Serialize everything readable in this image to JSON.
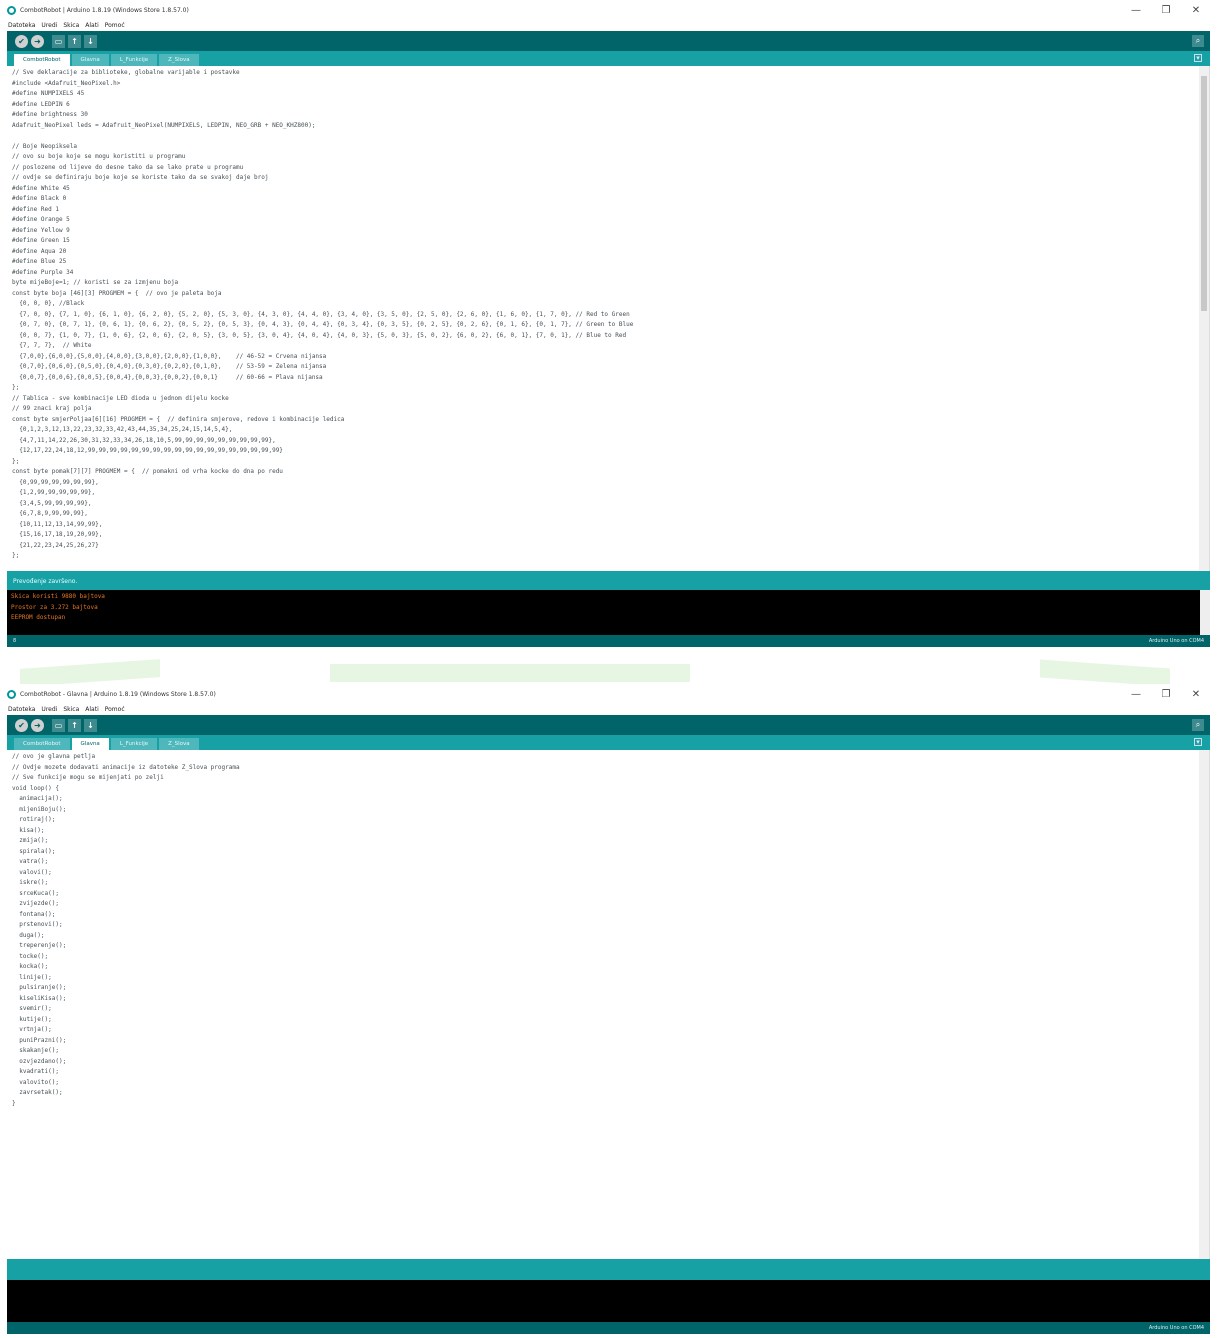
{
  "win1": {
    "title": "CombotRobot | Arduino 1.8.19 (Windows Store 1.8.57.0)",
    "menus": [
      "Datoteka",
      "Uredi",
      "Skica",
      "Alati",
      "Pomoć"
    ],
    "tabs": [
      "CombotRobot",
      "Glavna",
      "L_Funkcije",
      "Z_Slova"
    ],
    "active_tab": 0,
    "code": [
      "// Sve deklaracije za biblioteke, globalne varijable i postavke",
      "#include <Adafruit_NeoPixel.h>",
      "#define NUMPIXELS 45",
      "#define LEDPIN 6",
      "#define brightness 30",
      "Adafruit_NeoPixel leds = Adafruit_NeoPixel(NUMPIXELS, LEDPIN, NEO_GRB + NEO_KHZ800);",
      "",
      "// Boje Neopiksela",
      "// ovo su boje koje se mogu koristiti u programu",
      "// poslozene od lijeve do desne tako da se lako prate u programu",
      "// ovdje se definiraju boje koje se koriste tako da se svakoj daje broj",
      "#define White 45",
      "#define Black 0",
      "#define Red 1",
      "#define Orange 5",
      "#define Yellow 9",
      "#define Green 15",
      "#define Aqua 20",
      "#define Blue 25",
      "#define Purple 34",
      "byte mijeBoje=1; // koristi se za izmjenu boja",
      "const byte boja [46][3] PROGMEM = {  // ovo je paleta boja",
      "  {0, 0, 0}, //Black",
      "  {7, 0, 0}, {7, 1, 0}, {6, 1, 0}, {6, 2, 0}, {5, 2, 0}, {5, 3, 0}, {4, 3, 0}, {4, 4, 0}, {3, 4, 0}, {3, 5, 0}, {2, 5, 0}, {2, 6, 0}, {1, 6, 0}, {1, 7, 0}, // Red to Green",
      "  {0, 7, 0}, {0, 7, 1}, {0, 6, 1}, {0, 6, 2}, {0, 5, 2}, {0, 5, 3}, {0, 4, 3}, {0, 4, 4}, {0, 3, 4}, {0, 3, 5}, {0, 2, 5}, {0, 2, 6}, {0, 1, 6}, {0, 1, 7}, // Green to Blue",
      "  {0, 0, 7}, {1, 0, 7}, {1, 0, 6}, {2, 0, 6}, {2, 0, 5}, {3, 0, 5}, {3, 0, 4}, {4, 0, 4}, {4, 0, 3}, {5, 0, 3}, {5, 0, 2}, {6, 0, 2}, {6, 0, 1}, {7, 0, 1}, // Blue to Red",
      "  {7, 7, 7},  // White",
      "  {7,0,0},{6,0,0},{5,0,0},{4,0,0},{3,0,0},{2,0,0},{1,0,0},    // 46-52 = Crvena nijansa",
      "  {0,7,0},{0,6,0},{0,5,0},{0,4,0},{0,3,0},{0,2,0},{0,1,0},    // 53-59 = Zelena nijansa",
      "  {0,0,7},{0,0,6},{0,0,5},{0,0,4},{0,0,3},{0,0,2},{0,0,1}     // 60-66 = Plava nijansa",
      "};",
      "// Tablica - sve kombinacije LED dioda u jednom dijelu kocke",
      "// 99 znaci kraj polja",
      "const byte smjerPoljaa[6][16] PROGMEM = {  // definira smjerove, redove i kombinacije ledica",
      "  {0,1,2,3,12,13,22,23,32,33,42,43,44,35,34,25,24,15,14,5,4},",
      "  {4,7,11,14,22,26,30,31,32,33,34,26,18,10,5,99,99,99,99,99,99,99,99,99},",
      "  {12,17,22,24,18,12,99,99,99,99,99,99,99,99,99,99,99,99,99,99,99,99,99,99}",
      "};",
      "const byte pomak[7][7] PROGMEM = {  // pomakni od vrha kocke do dna po redu",
      "  {0,99,99,99,99,99,99},",
      "  {1,2,99,99,99,99,99},",
      "  {3,4,5,99,99,99,99},",
      "  {6,7,8,9,99,99,99},",
      "  {10,11,12,13,14,99,99},",
      "  {15,16,17,18,19,20,99},",
      "  {21,22,23,24,25,26,27}",
      "};"
    ],
    "status": "Prevođenje završeno.",
    "console": [
      "Skica koristi 9880 bajtova",
      "Prostor za 3.272 bajtova",
      "EEPROM dostupan"
    ],
    "line": "8",
    "board": "Arduino Uno on COM4"
  },
  "win2": {
    "title": "CombotRobot - Glavna | Arduino 1.8.19 (Windows Store 1.8.57.0)",
    "menus": [
      "Datoteka",
      "Uredi",
      "Skica",
      "Alati",
      "Pomoć"
    ],
    "tabs": [
      "CombotRobot",
      "Glavna",
      "L_Funkcije",
      "Z_Slova"
    ],
    "active_tab": 1,
    "code": [
      "// ovo je glavna petlja",
      "// Ovdje mozete dodavati animacije iz datoteke Z_Slova programa",
      "// Sve funkcije mogu se mijenjati po zelji",
      "void loop() {",
      "  animacija();",
      "  mijeniBoju();",
      "  rotiraj();",
      "  kisa();",
      "  zmija();",
      "  spirala();",
      "  vatra();",
      "  valovi();",
      "  iskre();",
      "  srceKuca();",
      "  zvijezde();",
      "  fontana();",
      "  prstenovi();",
      "  duga();",
      "  treperenje();",
      "  tocke();",
      "  kocka();",
      "  linije();",
      "  pulsiranje();",
      "  kiseliKisa();",
      "  svemir();",
      "  kutije();",
      "  vrtnja();",
      "  puniPrazni();",
      "  skakanje();",
      "  ozvjezdano();",
      "  kvadrati();",
      "  valovito();",
      "  zavrsetak();",
      "}"
    ],
    "board": "Arduino Uno on COM4"
  },
  "icons": {
    "verify": "✔",
    "upload": "➜",
    "new": "▭",
    "open": "↑",
    "save": "↓",
    "serial": "⌕",
    "tab_menu": "▾",
    "minimize": "—",
    "maximize": "❐",
    "close": "✕"
  },
  "colors": {
    "teal_dark": "#006468",
    "teal": "#17a1a5",
    "console_text": "#e97722"
  }
}
